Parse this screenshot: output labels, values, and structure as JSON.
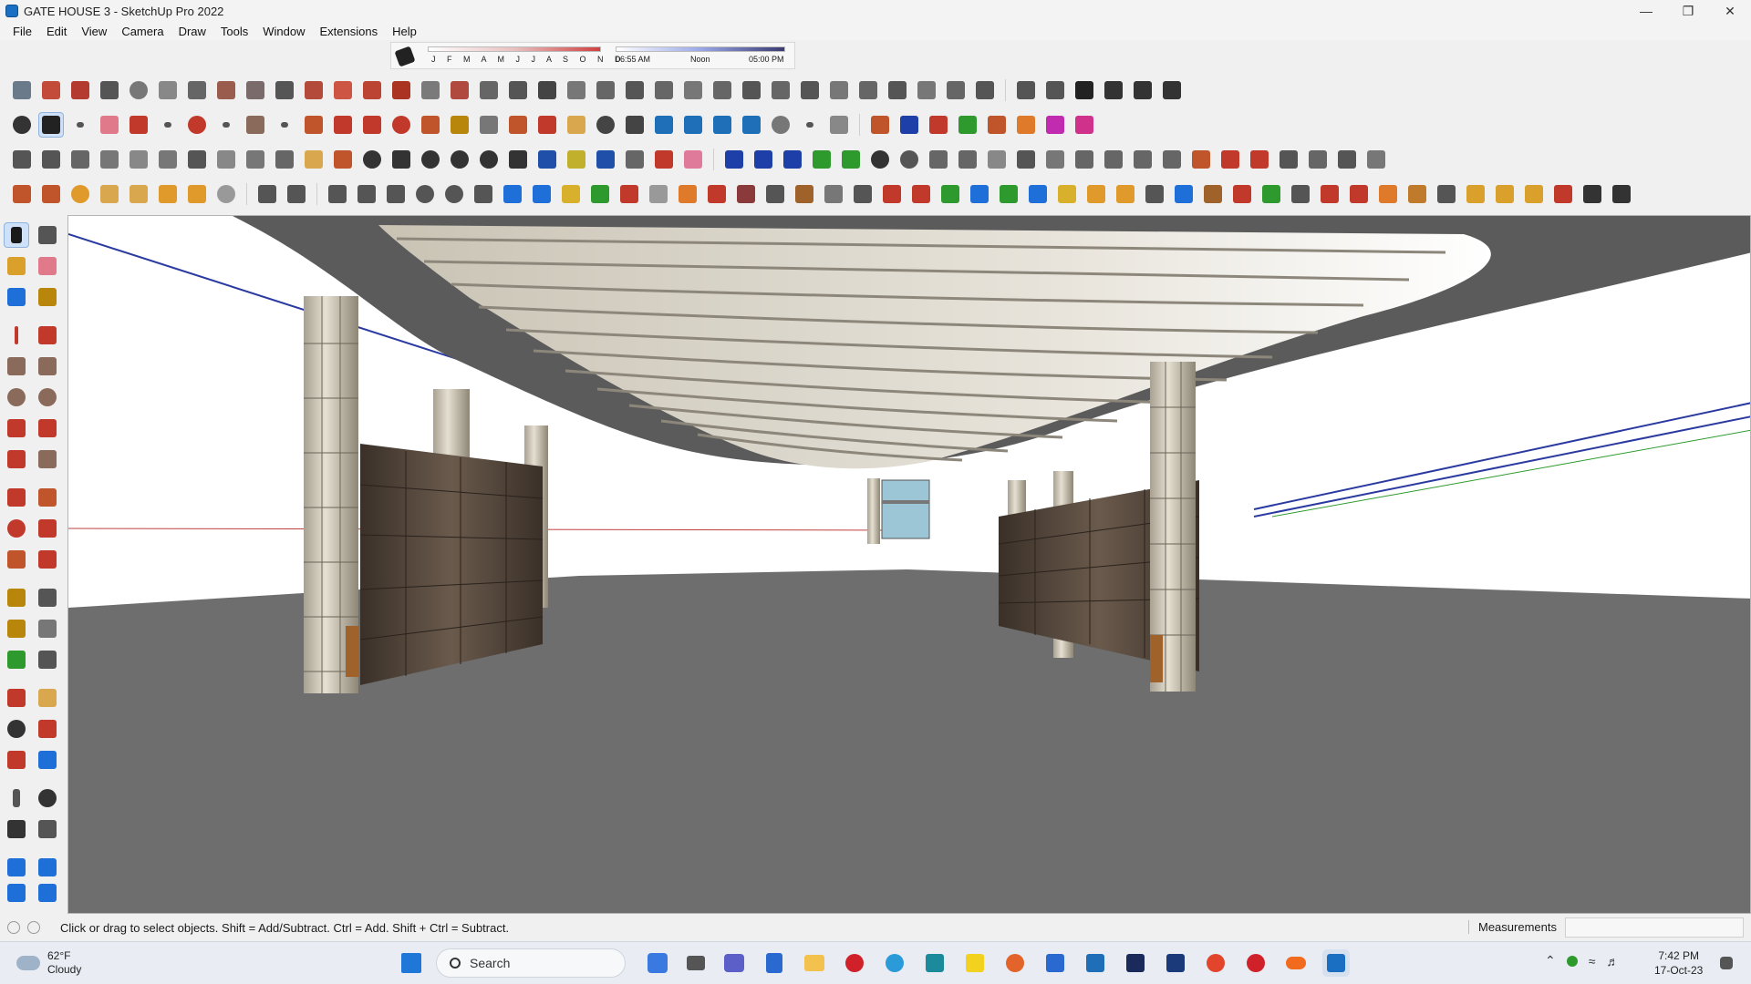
{
  "window": {
    "title": "GATE HOUSE 3 - SketchUp Pro 2022",
    "controls": [
      "minimize",
      "maximize",
      "close"
    ]
  },
  "menu": {
    "items": [
      "File",
      "Edit",
      "View",
      "Camera",
      "Draw",
      "Tools",
      "Window",
      "Extensions",
      "Help"
    ]
  },
  "shadow_settings": {
    "months": "J F M A M J J A S O N D",
    "time_start": "06:55 AM",
    "time_mid": "Noon",
    "time_end": "05:00 PM"
  },
  "status": {
    "hint": "Click or drag to select objects. Shift = Add/Subtract. Ctrl = Add. Shift + Ctrl = Subtract.",
    "measurements_label": "Measurements",
    "measurements_value": ""
  },
  "taskbar": {
    "weather_temp": "62°F",
    "weather_desc": "Cloudy",
    "search_label": "Search",
    "time": "7:42 PM",
    "date": "17-Oct-23"
  },
  "colors": {
    "toolbar_bg": "#f0f0f0",
    "viewport_ground": "#6e6e6e",
    "canopy_underside": "#d9d4c8",
    "column_stone": "#d8d2c2",
    "wall_dark": "#4a3e33",
    "accent_blue": "#2a3aa0",
    "accent_green": "#2e9a2e"
  }
}
